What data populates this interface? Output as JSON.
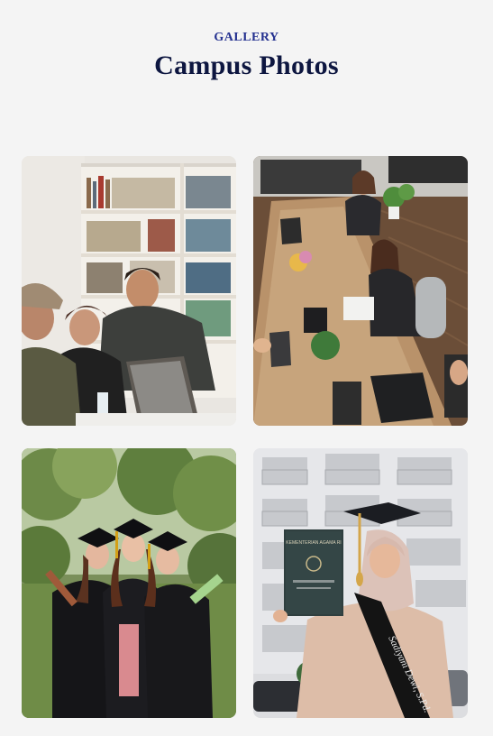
{
  "section": {
    "eyebrow": "GALLERY",
    "title": "Campus Photos"
  },
  "photos": [
    {
      "caption": "",
      "subject": "students laughing around laptop in library"
    },
    {
      "caption": "",
      "subject": "people working at long wooden table"
    },
    {
      "caption": "",
      "subject": "three graduates in caps and gowns"
    },
    {
      "caption": "",
      "subject": "graduate in hijab holding diploma"
    }
  ],
  "sash_text": "Sadiyani Dewi, S.Pd.",
  "diploma_text": "KEMENTERIAN AGAMA RI",
  "colors": {
    "eyebrow": "#23308f",
    "title": "#0d1640",
    "background": "#f4f4f4"
  }
}
